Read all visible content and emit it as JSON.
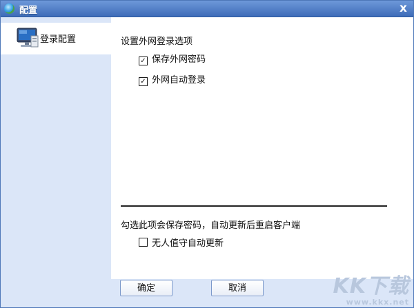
{
  "window": {
    "title": "配置",
    "close_glyph": "x"
  },
  "sidebar": {
    "items": [
      {
        "label": "登录配置",
        "icon": "monitor-icon",
        "selected": true
      }
    ]
  },
  "content": {
    "section_title": "设置外网登录选项",
    "options": [
      {
        "label": "保存外网密码",
        "checked": true
      },
      {
        "label": "外网自动登录",
        "checked": true
      }
    ],
    "hint": "勾选此项会保存密码，自动更新后重启客户端",
    "auto_update": {
      "label": "无人值守自动更新",
      "checked": false
    }
  },
  "buttons": {
    "ok_label": "确定",
    "cancel_label": "取消"
  },
  "watermark": {
    "big": "KK下载",
    "small": "www.kkx.net"
  },
  "colors": {
    "titlebar": "#3e6cb8",
    "sidebar_bg": "#dbe6f8",
    "border": "#4d77b8"
  }
}
